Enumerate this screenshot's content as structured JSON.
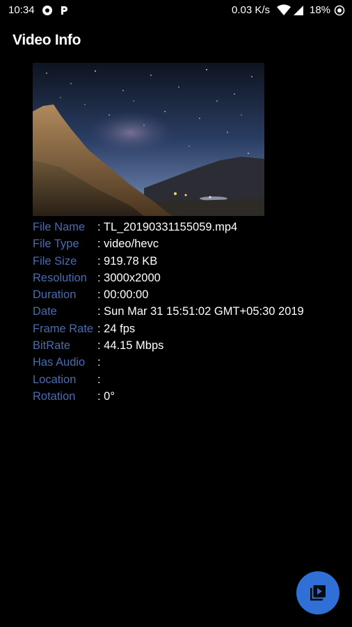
{
  "status_bar": {
    "time": "10:34",
    "net_speed": "0.03 K/s",
    "battery": "18%",
    "icons": [
      "record-icon",
      "parking-icon",
      "wifi-icon",
      "signal-icon",
      "battery-icon"
    ]
  },
  "app_bar": {
    "title": "Video Info"
  },
  "thumbnail": {
    "icon": "video-thumbnail-image"
  },
  "info": {
    "rows": [
      {
        "label": "File Name",
        "value": ": TL_20190331155059.mp4"
      },
      {
        "label": "File Type",
        "value": ": video/hevc"
      },
      {
        "label": "File Size",
        "value": ": 919.78 KB"
      },
      {
        "label": "Resolution",
        "value": ": 3000x2000"
      },
      {
        "label": "Duration",
        "value": ": 00:00:00"
      },
      {
        "label": "Date",
        "value": ": Sun Mar 31 15:51:02 GMT+05:30 2019"
      },
      {
        "label": "Frame Rate",
        "value": ": 24 fps"
      },
      {
        "label": "BitRate",
        "value": ": 44.15 Mbps"
      },
      {
        "label": "Has Audio",
        "value": ":"
      },
      {
        "label": "Location",
        "value": ":"
      },
      {
        "label": "Rotation",
        "value": ": 0°"
      }
    ]
  },
  "fab": {
    "icon": "play-video-icon",
    "color": "#2f6fd6"
  }
}
